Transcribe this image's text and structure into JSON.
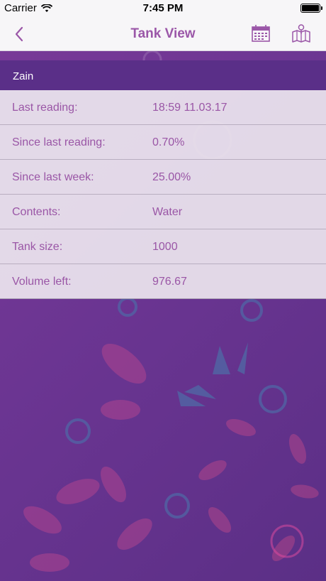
{
  "status_bar": {
    "carrier": "Carrier",
    "time": "7:45 PM"
  },
  "nav": {
    "title": "Tank View",
    "icons": [
      "chevron-left-icon",
      "calendar-icon",
      "map-icon"
    ]
  },
  "tank": {
    "owner": "Zain",
    "details": [
      {
        "label": "Last reading:",
        "value": "18:59 11.03.17"
      },
      {
        "label": "Since last reading:",
        "value": "0.70%"
      },
      {
        "label": "Since last week:",
        "value": "25.00%"
      },
      {
        "label": "Contents:",
        "value": "Water"
      },
      {
        "label": "Tank size:",
        "value": "1000"
      },
      {
        "label": "Volume left:",
        "value": "976.67"
      }
    ]
  },
  "colors": {
    "accent": "#9b57a8",
    "header_bg": "#5a2f88",
    "background": "#6b3592"
  }
}
